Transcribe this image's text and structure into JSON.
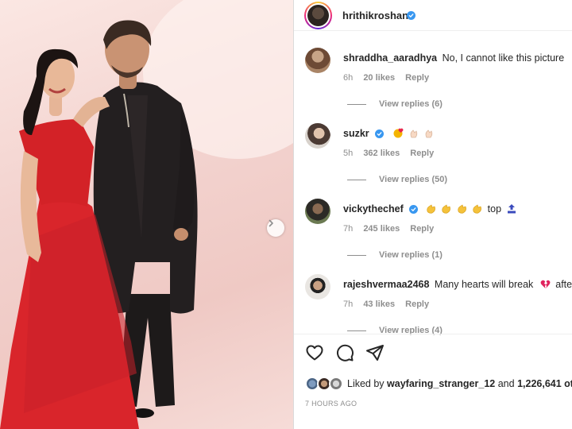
{
  "post": {
    "author": "hrithikroshan",
    "verified": true,
    "next_icon": "chevron-right-icon"
  },
  "comments": [
    {
      "username": "shraddha_aaradhya",
      "verified": false,
      "text": "No, I cannot like this picture",
      "emojis": [],
      "time": "6h",
      "likes": "20 likes",
      "reply": "Reply",
      "view_replies": "View replies (6)"
    },
    {
      "username": "suzkr",
      "verified": true,
      "text": "",
      "emojis": [
        "heart-kiss-emoji",
        "clap-emoji",
        "clap-emoji"
      ],
      "time": "5h",
      "likes": "362 likes",
      "reply": "Reply",
      "view_replies": "View replies (50)"
    },
    {
      "username": "vickythechef",
      "verified": true,
      "text": "top",
      "emojis": [
        "clap-emoji",
        "clap-emoji",
        "clap-emoji",
        "clap-emoji"
      ],
      "trailing_emoji": "top-arrow-emoji",
      "time": "7h",
      "likes": "245 likes",
      "reply": "Reply",
      "view_replies": "View replies (1)"
    },
    {
      "username": "rajeshvermaa2468",
      "verified": false,
      "text": "Many hearts will break",
      "trailing_emoji": "broken-heart-emoji",
      "text_after": "afte",
      "time": "7h",
      "likes": "43 likes",
      "reply": "Reply",
      "view_replies": "View replies (4)"
    }
  ],
  "actions": {
    "like_icon": "heart-icon",
    "comment_icon": "comment-icon",
    "share_icon": "share-icon"
  },
  "liked_by": {
    "prefix": "Liked by",
    "user": "wayfaring_stranger_12",
    "middle": "and",
    "count": "1,226,641 ot"
  },
  "timestamp": "7 HOURS AGO",
  "colors": {
    "verified_blue": "#3897f0",
    "text_primary": "#262626",
    "text_secondary": "#8e8e8e",
    "dress_red": "#d9252b"
  }
}
